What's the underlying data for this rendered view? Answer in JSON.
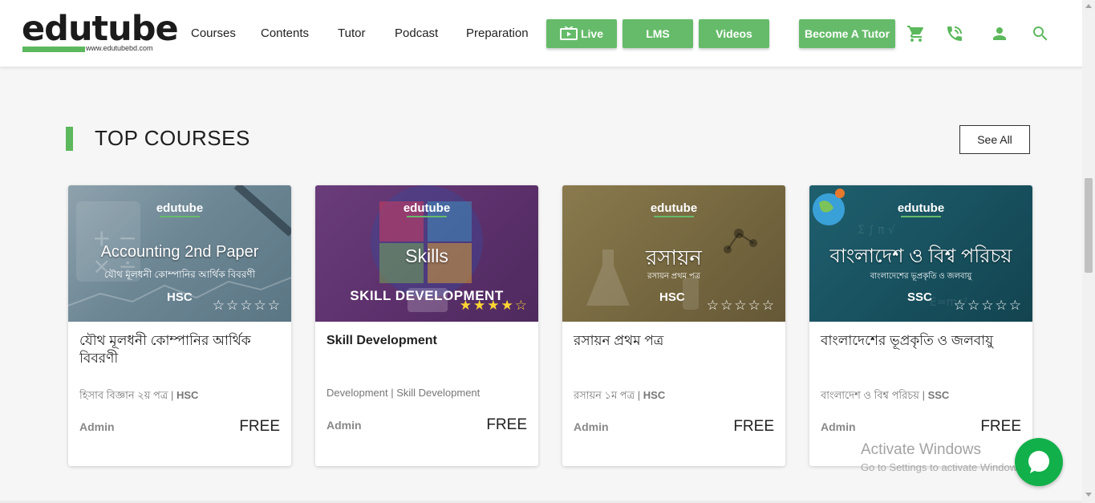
{
  "brand": {
    "name": "edutube",
    "url": "www.edutubebd.com",
    "accent": "#5cb85c"
  },
  "nav": {
    "items": [
      "Courses",
      "Contents",
      "Tutor",
      "Podcast",
      "Preparation"
    ]
  },
  "buttons": {
    "live": "Live",
    "lms": "LMS",
    "videos": "Videos",
    "become_tutor": "Become A Tutor"
  },
  "header_icons": [
    "cart-icon",
    "phone-icon",
    "user-icon",
    "search-icon"
  ],
  "section": {
    "title": "TOP COURSES",
    "see_all": "See All"
  },
  "courses": [
    {
      "thumb_title": "Accounting 2nd Paper",
      "thumb_sub": "যৌথ মূলধনী কোম্পানির আর্থিক বিবরণী",
      "thumb_level": "HSC",
      "rating": 0,
      "title": "যৌথ মূলধনী কোম্পানির আর্থিক বিবরণী",
      "subject": "হিসাব বিজ্ঞান ২য় পত্র",
      "level": "HSC",
      "author": "Admin",
      "price": "FREE"
    },
    {
      "thumb_title": "Skills",
      "thumb_sub": "SKILL DEVELOPMENT",
      "thumb_level": "",
      "rating": 4.5,
      "title": "Skill Development",
      "subject": "Development",
      "level": "Skill Development",
      "author": "Admin",
      "price": "FREE"
    },
    {
      "thumb_title": "রসায়ন",
      "thumb_sub": "রসায়ন প্রথম পত্র",
      "thumb_level": "HSC",
      "rating": 0,
      "title": "রসায়ন প্রথম পত্র",
      "subject": "রসায়ন ১ম পত্র",
      "level": "HSC",
      "author": "Admin",
      "price": "FREE"
    },
    {
      "thumb_title": "বাংলাদেশ ও বিশ্ব পরিচয়",
      "thumb_sub": "বাংলাদেশের ভূপ্রকৃতি ও জলবায়ু",
      "thumb_level": "SSC",
      "rating": 0,
      "title": "বাংলাদেশের ভূপ্রকৃতি ও জলবায়ু",
      "subject": "বাংলাদেশ ও বিশ্ব পরিচয়",
      "level": "SSC",
      "author": "Admin",
      "price": "FREE"
    }
  ],
  "watermark": {
    "line1": "Activate Windows",
    "line2": "Go to Settings to activate Windows."
  }
}
